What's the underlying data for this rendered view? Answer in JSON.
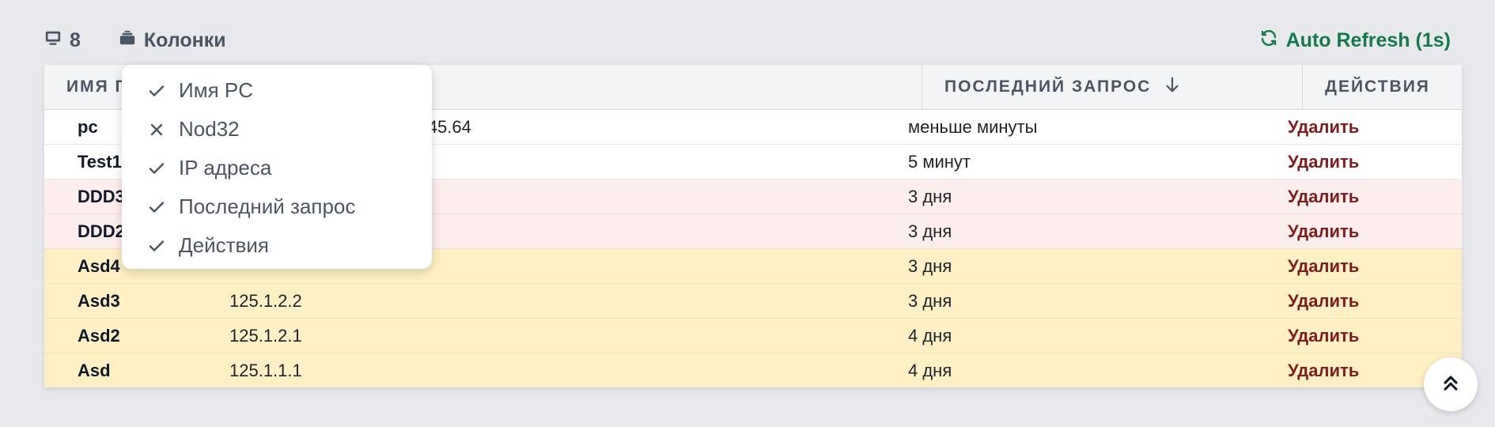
{
  "toolbar": {
    "count": "8",
    "count_icon": "monitor-icon",
    "columns_label": "Колонки",
    "columns_icon": "columns-icon",
    "refresh_label": "Auto Refresh (1s)",
    "refresh_icon": "refresh-icon",
    "refresh_color": "#157a4c"
  },
  "table": {
    "headers": [
      "Имя PC",
      "IP адреса",
      "Последний запрос",
      "Действия"
    ],
    "visible_headers": {
      "col1": "ИМЯ П",
      "col3": "ПОСЛЕДНИЙ ЗАПРОС",
      "col4": "ДЕЙСТВИЯ"
    },
    "sort_column": "Последний запрос",
    "sort_direction": "desc",
    "rows": [
      {
        "name": "pc",
        "ip": ", 192.168.45.63, 192.168.45.64",
        "last": "меньше минуты",
        "action": "Удалить",
        "status": "normal"
      },
      {
        "name": "Test1",
        "ip": "",
        "last": "5 минут",
        "action": "Удалить",
        "status": "normal"
      },
      {
        "name": "DDD3",
        "ip": "",
        "last": "3 дня",
        "action": "Удалить",
        "status": "old"
      },
      {
        "name": "DDD2",
        "ip": "",
        "last": "3 дня",
        "action": "Удалить",
        "status": "old"
      },
      {
        "name": "Asd4",
        "ip": "",
        "last": "3 дня",
        "action": "Удалить",
        "status": "stale"
      },
      {
        "name": "Asd3",
        "ip": "125.1.2.2",
        "last": "3 дня",
        "action": "Удалить",
        "status": "stale"
      },
      {
        "name": "Asd2",
        "ip": "125.1.2.1",
        "last": "4 дня",
        "action": "Удалить",
        "status": "stale"
      },
      {
        "name": "Asd",
        "ip": "125.1.1.1",
        "last": "4 дня",
        "action": "Удалить",
        "status": "stale"
      }
    ],
    "colors": {
      "normal": "#ffffff",
      "old": "#fdeeee",
      "stale": "#fdf0c4",
      "action": "#7f1d1d"
    }
  },
  "columns_menu": {
    "items": [
      {
        "label": "Имя PC",
        "checked": true
      },
      {
        "label": "Nod32",
        "checked": false
      },
      {
        "label": "IP адреса",
        "checked": true
      },
      {
        "label": "Последний запрос",
        "checked": true
      },
      {
        "label": "Действия",
        "checked": true
      }
    ]
  },
  "scroll_top": {
    "icon": "chevrons-up-icon"
  }
}
